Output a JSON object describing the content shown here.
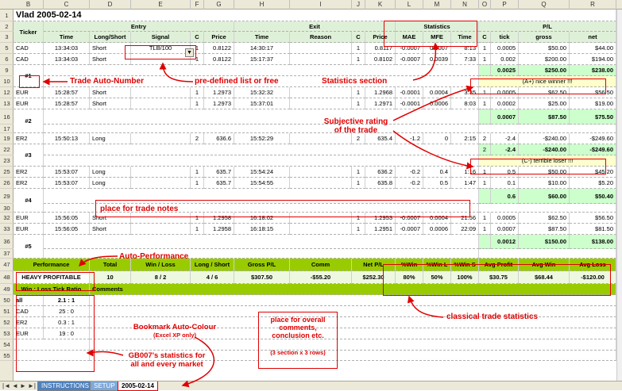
{
  "columns": [
    "B",
    "C",
    "D",
    "E",
    "F",
    "G",
    "H",
    "I",
    "J",
    "K",
    "L",
    "M",
    "N",
    "O",
    "P",
    "Q",
    "R"
  ],
  "rows": [
    "1",
    "2",
    "3",
    "5",
    "6",
    "9",
    "10",
    "12",
    "13",
    "16",
    "17",
    "19",
    "22",
    "23",
    "25",
    "26",
    "29",
    "30",
    "32",
    "33",
    "36",
    "37",
    "47",
    "48",
    "49",
    "50",
    "51",
    "52",
    "53",
    "54",
    "55"
  ],
  "title": "Vlad 2005-02-14",
  "headers": {
    "ticker": "Ticker",
    "entry": "Entry",
    "exit": "Exit",
    "statistics": "Statistics",
    "pl": "P/L",
    "time": "Time",
    "longshort": "Long/Short",
    "signal": "Signal",
    "c": "C",
    "price": "Price",
    "reason": "Reason",
    "mae": "MAE",
    "mfe": "MFE",
    "tick": "tick",
    "gross": "gross",
    "net": "net"
  },
  "trades": [
    {
      "row": "r5",
      "ticker": "CAD",
      "t1": "13:34:03",
      "ls": "Short",
      "signal": "TLB/100",
      "c1": "1",
      "p1": "0.8122",
      "t2": "14:30:17",
      "reason": "",
      "c2": "1",
      "p2": "0.8117",
      "mae": "-0.0007",
      "mfe": "0.0007",
      "tm": "8:13",
      "c3": "1",
      "tick": "0.0005",
      "gross": "$50.00",
      "net": "$44.00"
    },
    {
      "row": "r6",
      "ticker": "CAD",
      "t1": "13:34:03",
      "ls": "Short",
      "signal": "",
      "c1": "1",
      "p1": "0.8122",
      "t2": "15:17:37",
      "reason": "",
      "c2": "1",
      "p2": "0.8102",
      "mae": "-0.0007",
      "mfe": "0.0039",
      "tm": "7:33",
      "c3": "1",
      "tick": "0.002",
      "gross": "$200.00",
      "net": "$194.00"
    },
    {
      "row": "r12",
      "ticker": "EUR",
      "t1": "15:28:57",
      "ls": "Short",
      "signal": "",
      "c1": "1",
      "p1": "1.2973",
      "t2": "15:32:32",
      "reason": "",
      "c2": "1",
      "p2": "1.2968",
      "mae": "-0.0001",
      "mfe": "0.0004",
      "tm": "3:35",
      "c3": "1",
      "tick": "0.0005",
      "gross": "$62.50",
      "net": "$56.50"
    },
    {
      "row": "r13",
      "ticker": "EUR",
      "t1": "15:28:57",
      "ls": "Short",
      "signal": "",
      "c1": "1",
      "p1": "1.2973",
      "t2": "15:37:01",
      "reason": "",
      "c2": "1",
      "p2": "1.2971",
      "mae": "-0.0001",
      "mfe": "0.0006",
      "tm": "8:03",
      "c3": "1",
      "tick": "0.0002",
      "gross": "$25.00",
      "net": "$19.00"
    },
    {
      "row": "r19",
      "ticker": "ER2",
      "t1": "15:50:13",
      "ls": "Long",
      "signal": "",
      "c1": "2",
      "p1": "636.6",
      "t2": "15:52:29",
      "reason": "",
      "c2": "2",
      "p2": "635.4",
      "mae": "-1.2",
      "mfe": "0",
      "tm": "2:15",
      "c3": "2",
      "tick": "-2.4",
      "gross": "-$240.00",
      "net": "-$249.60"
    },
    {
      "row": "r25",
      "ticker": "ER2",
      "t1": "15:53:07",
      "ls": "Long",
      "signal": "",
      "c1": "1",
      "p1": "635.7",
      "t2": "15:54:24",
      "reason": "",
      "c2": "1",
      "p2": "636.2",
      "mae": "-0.2",
      "mfe": "0.4",
      "tm": "1:16",
      "c3": "1",
      "tick": "0.5",
      "gross": "$50.00",
      "net": "$45.20"
    },
    {
      "row": "r26",
      "ticker": "ER2",
      "t1": "15:53:07",
      "ls": "Long",
      "signal": "",
      "c1": "1",
      "p1": "635.7",
      "t2": "15:54:55",
      "reason": "",
      "c2": "1",
      "p2": "635.8",
      "mae": "-0.2",
      "mfe": "0.5",
      "tm": "1:47",
      "c3": "1",
      "tick": "0.1",
      "gross": "$10.00",
      "net": "$5.20"
    },
    {
      "row": "r32",
      "ticker": "EUR",
      "t1": "15:56:05",
      "ls": "Short",
      "signal": "",
      "c1": "1",
      "p1": "1.2958",
      "t2": "16:18:02",
      "reason": "",
      "c2": "1",
      "p2": "1.2953",
      "mae": "-0.0007",
      "mfe": "0.0004",
      "tm": "21:56",
      "c3": "1",
      "tick": "0.0005",
      "gross": "$62.50",
      "net": "$56.50"
    },
    {
      "row": "r33",
      "ticker": "EUR",
      "t1": "15:56:05",
      "ls": "Short",
      "signal": "",
      "c1": "1",
      "p1": "1.2958",
      "t2": "16:18:15",
      "reason": "",
      "c2": "1",
      "p2": "1.2951",
      "mae": "-0.0007",
      "mfe": "0.0006",
      "tm": "22:09",
      "c3": "1",
      "tick": "0.0007",
      "gross": "$87.50",
      "net": "$81.50"
    }
  ],
  "groups": [
    {
      "label": "#1",
      "tick": "0.0025",
      "gross": "$250.00",
      "net": "$238.00",
      "rating": "(A+) nice winner !!!"
    },
    {
      "label": "#2",
      "tick": "0.0007",
      "gross": "$87.50",
      "net": "$75.50"
    },
    {
      "label": "#3",
      "c": "2",
      "tick": "-2.4",
      "gross": "-$240.00",
      "net": "-$249.60",
      "rating": "(C-) terrible loser !!!"
    },
    {
      "label": "#4",
      "tick": "0.6",
      "gross": "$60.00",
      "net": "$50.40"
    },
    {
      "label": "#5",
      "tick": "0.0012",
      "gross": "$150.00",
      "net": "$138.00"
    }
  ],
  "summary": {
    "headers": [
      "Performance",
      "Total",
      "Win / Loss",
      "Long / Short",
      "Gross P/L",
      "Comm",
      "Net P/L",
      "%Win",
      "%Win L",
      "%Win S",
      "Avg Profit",
      "Avg Win",
      "Avg Loss"
    ],
    "values": [
      "HEAVY PROFITABLE",
      "10",
      "8 / 2",
      "4 / 6",
      "$307.50",
      "-$55.20",
      "$252.30",
      "80%",
      "50%",
      "100%",
      "$30.75",
      "$68.44",
      "-$120.00"
    ]
  },
  "ratio": {
    "header": "Win : Loss Tick Ratio",
    "comments": "Comments",
    "rows": [
      [
        "all",
        "2.1 : 1"
      ],
      [
        "CAD",
        "25 : 0"
      ],
      [
        "ER2",
        "0.3 : 1"
      ],
      [
        "EUR",
        "19 : 0"
      ]
    ]
  },
  "annotations": {
    "trade_auto_number": "Trade Auto-Number",
    "predefined": "pre-defined list or free",
    "stats_section": "Statistics section",
    "subjective": "Subjective rating\nof the trade",
    "trade_notes": "place for trade notes",
    "auto_perf": "Auto-Performance",
    "classical": "classical trade statistics",
    "bookmark": "Bookmark Auto-Colour",
    "bookmark_sub": "(Excel XP only)",
    "overall": "place for overall\ncomments,\nconclusion etc.",
    "overall_sub": "(3 section x 3 rows)",
    "gb007": "GB007's statistics for\nall and every market"
  },
  "tabs": [
    "INSTRUCTIONS",
    "SETUP",
    "2005-02-14"
  ]
}
